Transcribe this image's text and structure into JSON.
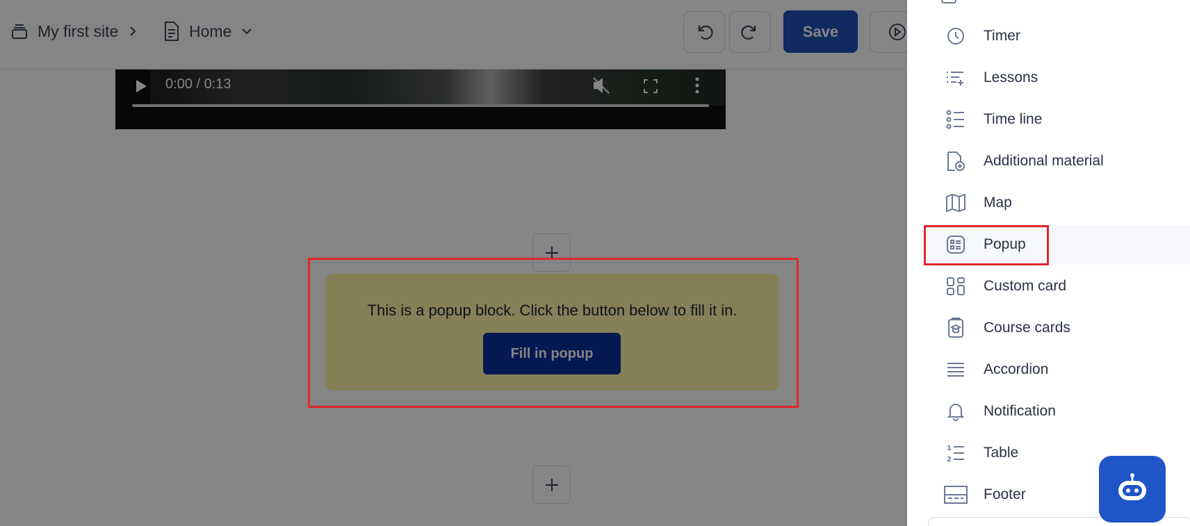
{
  "breadcrumb": {
    "site": "My first site",
    "page": "Home"
  },
  "toolbar": {
    "save_label": "Save"
  },
  "video": {
    "time": "0:00 / 0:13"
  },
  "popup_block": {
    "text": "This is a popup block. Click the button below to fill it in.",
    "button_label": "Fill in popup",
    "background": "#fff5a9"
  },
  "highlight_color": "#e1262c",
  "sidebar": {
    "items": [
      {
        "label": "Timer",
        "icon": "clock-icon"
      },
      {
        "label": "Lessons",
        "icon": "lessons-icon"
      },
      {
        "label": "Time line",
        "icon": "timeline-icon"
      },
      {
        "label": "Additional material",
        "icon": "file-plus-icon"
      },
      {
        "label": "Map",
        "icon": "map-icon"
      },
      {
        "label": "Popup",
        "icon": "popup-icon",
        "selected": true
      },
      {
        "label": "Custom card",
        "icon": "grid-icon"
      },
      {
        "label": "Course cards",
        "icon": "course-cards-icon"
      },
      {
        "label": "Accordion",
        "icon": "accordion-icon"
      },
      {
        "label": "Notification",
        "icon": "bell-icon"
      },
      {
        "label": "Table",
        "icon": "numbered-list-icon"
      },
      {
        "label": "Footer",
        "icon": "footer-icon"
      }
    ]
  }
}
